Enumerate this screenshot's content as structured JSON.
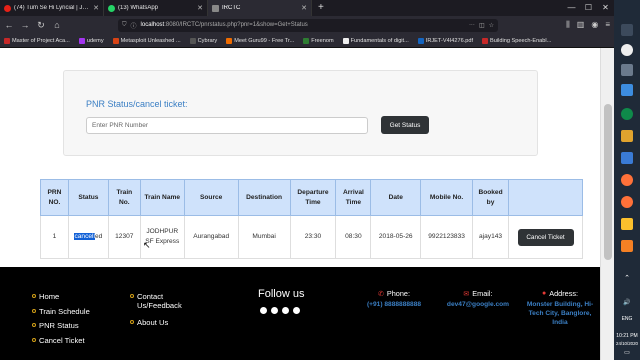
{
  "browser": {
    "tabs": [
      {
        "title": "(74) Tum Se Hi Lyricial | Jab We...",
        "color": "#e62117"
      },
      {
        "title": "(13) WhatsApp",
        "color": "#25d366"
      },
      {
        "title": "IRCTC",
        "color": "#888888"
      }
    ],
    "url_host": "localhost",
    "url_path": ":8080/IRCTC/pnrstatus.php?pnr=1&show=Get+Status",
    "bookmarks": [
      {
        "label": "Master of Project Aca...",
        "color": "#c62828"
      },
      {
        "label": "udemy",
        "color": "#a435f0"
      },
      {
        "label": "Metasploit Unleashed ...",
        "color": "#d84315"
      },
      {
        "label": "Cybrary",
        "color": "#555555"
      },
      {
        "label": "Meet Guru99 - Free Tr...",
        "color": "#ef6c00"
      },
      {
        "label": "Freenom",
        "color": "#2e7d32"
      },
      {
        "label": "Fundamentals of digit...",
        "color": "#eeeeee"
      },
      {
        "label": "IRJET-V4I4276.pdf",
        "color": "#1565c0"
      },
      {
        "label": "Building Speech-Enabl...",
        "color": "#c62828"
      }
    ]
  },
  "pnr_form": {
    "title": "PNR Status/cancel ticket:",
    "placeholder": "Enter PNR Number",
    "button": "Get Status"
  },
  "table": {
    "headers": [
      "PRN NO.",
      "Status",
      "Train No.",
      "Train Name",
      "Source",
      "Destination",
      "Departure Time",
      "Arrival Time",
      "Date",
      "Mobile No.",
      "Booked by"
    ],
    "row": {
      "prn": "1",
      "status_sel": "cancell",
      "status_rest": "ed",
      "train_no": "12307",
      "train_name": "JODHPUR SF Express",
      "source": "Aurangabad",
      "destination": "Mumbai",
      "departure": "23:30",
      "arrival": "08:30",
      "date": "2018-05-26",
      "mobile": "9922123833",
      "booked_by": "ajay143",
      "action": "Cancel Ticket"
    }
  },
  "footer": {
    "links_left": [
      "Home",
      "Train Schedule",
      "PNR Status",
      "Cancel Ticket"
    ],
    "links_mid": [
      "Contact Us/Feedback",
      "About Us"
    ],
    "follow": "Follow us",
    "social_icons": [
      "facebook-icon",
      "twitter-icon",
      "linkedin-icon",
      "instagram-icon"
    ],
    "phone_label": "Phone:",
    "phone": "(+91) 8888888888",
    "email_label": "Email:",
    "email": "dev47@google.com",
    "address_label": "Address:",
    "address": "Monster Building, Hi-Tech City, Banglore, India",
    "accent": "#3b7fc4"
  },
  "taskbar": {
    "lang": "ENG",
    "time": "10:21 PM",
    "date": "24/10/2020"
  }
}
